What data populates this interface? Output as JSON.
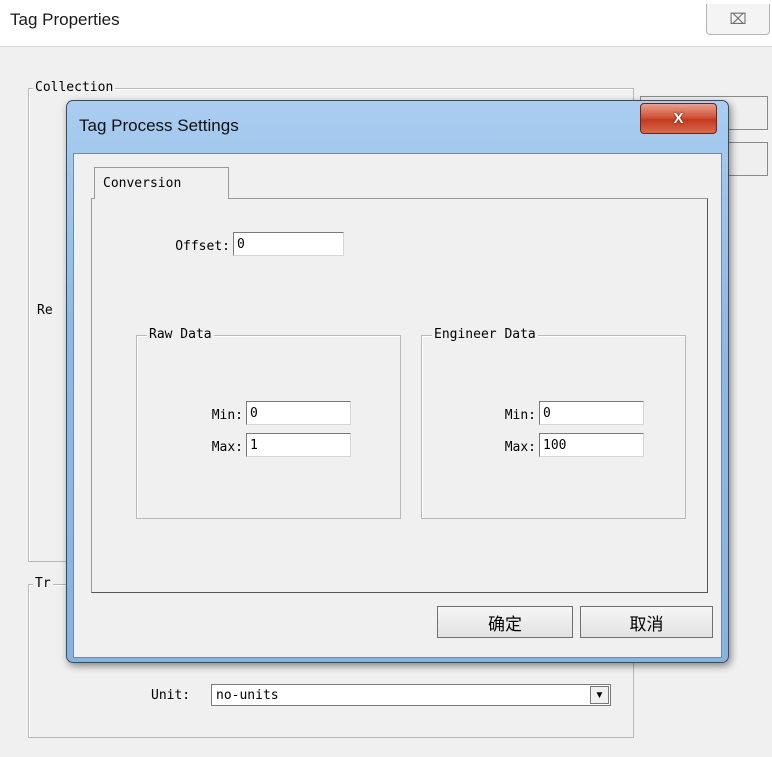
{
  "window": {
    "title": "Tag Properties",
    "close_glyph": "⌧"
  },
  "background": {
    "collection_label": "Collection",
    "trend_label": "Tr",
    "re_label": "Re",
    "unit": {
      "label": "Unit:",
      "value": "no-units"
    }
  },
  "dialog": {
    "title": "Tag Process Settings",
    "close_glyph": "X",
    "tab_label": "Conversion",
    "offset": {
      "label": "Offset:",
      "value": "0"
    },
    "raw_data": {
      "title": "Raw Data",
      "min_label": "Min:",
      "min_value": "0",
      "max_label": "Max:",
      "max_value": "1"
    },
    "engineer_data": {
      "title": "Engineer Data",
      "min_label": "Min:",
      "min_value": "0",
      "max_label": "Max:",
      "max_value": "100"
    },
    "ok_label": "确定",
    "cancel_label": "取消"
  },
  "colors": {
    "titlebar": "#8fb9e6",
    "close_button": "#c33a1f",
    "client": "#f0f0f0"
  }
}
